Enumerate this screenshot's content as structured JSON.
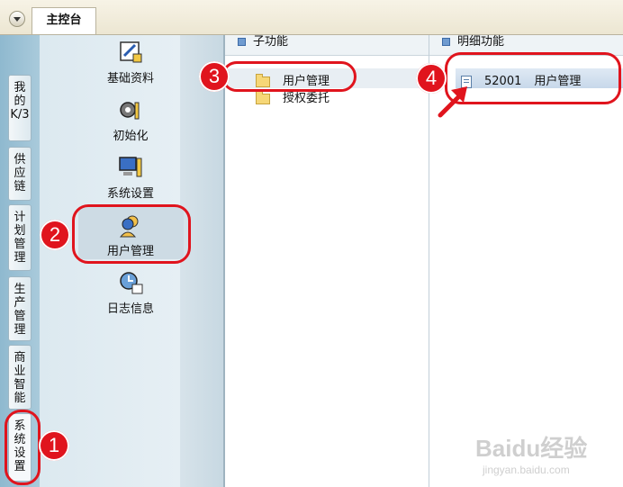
{
  "window": {
    "tab_label": "主控台"
  },
  "left_tabs": [
    {
      "label": "我的K/3"
    },
    {
      "label": "供应链"
    },
    {
      "label": "计划管理"
    },
    {
      "label": "生产管理"
    },
    {
      "label": "商业智能"
    },
    {
      "label": "系统设置"
    }
  ],
  "modules": [
    {
      "label": "基础资料",
      "icon": "basic-data-icon"
    },
    {
      "label": "初始化",
      "icon": "gear-init-icon"
    },
    {
      "label": "系统设置",
      "icon": "computer-settings-icon"
    },
    {
      "label": "用户管理",
      "icon": "user-manage-icon"
    },
    {
      "label": "日志信息",
      "icon": "log-clock-icon"
    }
  ],
  "subfunction": {
    "header": "子功能",
    "items": [
      {
        "label": "用户管理"
      },
      {
        "label": "授权委托"
      }
    ]
  },
  "detail": {
    "header": "明细功能",
    "items": [
      {
        "code": "52001",
        "label": "用户管理"
      }
    ]
  },
  "annotations": {
    "step1": "1",
    "step2": "2",
    "step3": "3",
    "step4": "4"
  },
  "watermark": {
    "brand": "Baidu经验",
    "url": "jingyan.baidu.com"
  },
  "colors": {
    "annotation_red": "#e0141d",
    "panel_blue": "#dce9f0"
  }
}
